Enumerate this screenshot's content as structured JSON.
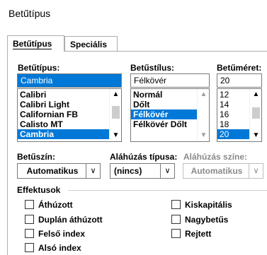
{
  "dialog": {
    "title": "Betűtípus"
  },
  "tabs": [
    {
      "label": "Betűtípus"
    },
    {
      "label": "Speciális"
    }
  ],
  "font": {
    "label": "Betűtípus:",
    "value": "Cambria",
    "items": [
      "Calibri",
      "Calibri Light",
      "Californian FB",
      "Calisto MT",
      "Cambria"
    ],
    "selected": "Cambria"
  },
  "style": {
    "label": "Betűstílus:",
    "value": "Félkövér",
    "items": [
      "Normál",
      "Dőlt",
      "Félkövér",
      "Félkövér Dőlt"
    ],
    "selected": "Félkövér"
  },
  "size": {
    "label": "Betűméret:",
    "value": "20",
    "items": [
      "12",
      "14",
      "16",
      "18",
      "20"
    ],
    "selected": "20"
  },
  "font_color": {
    "label": "Betűszín:",
    "value": "Automatikus"
  },
  "underline_style": {
    "label": "Aláhúzás típusa:",
    "value": "(nincs)"
  },
  "underline_color": {
    "label": "Aláhúzás színe:",
    "value": "Automatikus"
  },
  "effects": {
    "label": "Effektusok",
    "left": [
      {
        "label": "Áthúzott",
        "checked": false
      },
      {
        "label": "Duplán áthúzott",
        "checked": false
      },
      {
        "label": "Felső index",
        "checked": false
      },
      {
        "label": "Alsó index",
        "checked": false
      }
    ],
    "right": [
      {
        "label": "Kiskapitális",
        "checked": false
      },
      {
        "label": "Nagybetűs",
        "checked": false
      },
      {
        "label": "Rejtett",
        "checked": false
      }
    ]
  },
  "icons": {
    "scroll_up": "▲",
    "scroll_down": "▼",
    "dropdown": "∨"
  }
}
